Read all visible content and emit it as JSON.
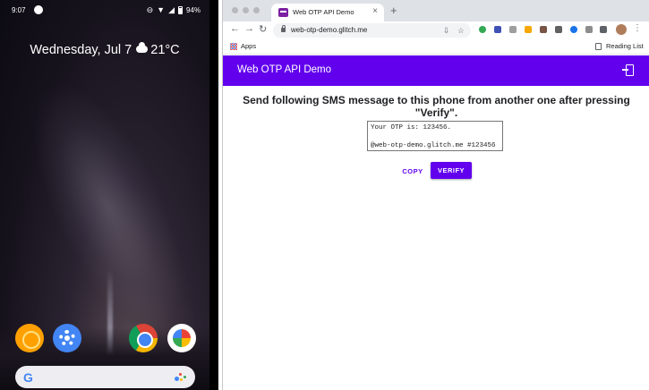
{
  "phone": {
    "status": {
      "time": "9:07",
      "battery": "94%"
    },
    "weather": {
      "date": "Wednesday, Jul 7",
      "temperature": "21°C",
      "icon": "cloud-icon"
    },
    "dock_apps": [
      "sun-app-icon",
      "settings-icon",
      "chrome-icon",
      "photos-icon"
    ],
    "search": {
      "logo": "G"
    }
  },
  "browser": {
    "tab": {
      "title": "Web OTP API Demo",
      "close": "×"
    },
    "new_tab": "+",
    "nav": {
      "back": "←",
      "forward": "→",
      "reload": "↻"
    },
    "url": "web-otp-demo.glitch.me",
    "bookmarks": {
      "apps_label": "Apps",
      "reading_list_label": "Reading List"
    }
  },
  "page": {
    "appbar_title": "Web OTP API Demo",
    "instructions": "Send following SMS message to this phone from another one after pressing \"Verify\".",
    "sms_lines": [
      "Your OTP is: 123456.",
      "",
      "@web-otp-demo.glitch.me #123456"
    ],
    "copy_label": "COPY",
    "verify_label": "VERIFY"
  },
  "colors": {
    "primary": "#6200ee",
    "appbar_text": "#ffffff",
    "tab_strip": "#dee1e6"
  }
}
